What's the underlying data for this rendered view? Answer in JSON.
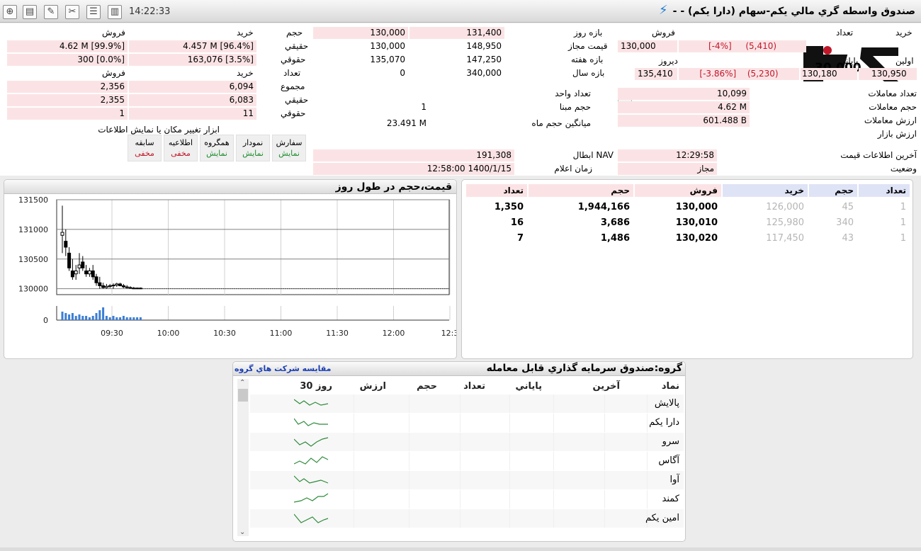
{
  "toolbar": {
    "clock": "14:22:33",
    "title": "صندوق واسطه گري مالي يكم-سهام (دارا يكم) - -",
    "icons": [
      "plus-square-icon",
      "calculator-icon",
      "edit-icon",
      "tools-icon",
      "list-icon",
      "bar-chart-icon",
      "bolt-icon"
    ]
  },
  "logo": {
    "visible_text": "30.000"
  },
  "price_block": {
    "buy_label": "خريد",
    "buy_count_label": "تعداد",
    "sell_label": "فروش",
    "last_value": "130,000",
    "last_change": "(5,410)",
    "last_change_pct": "[-4%]",
    "first_label": "اولين",
    "first_value": "130,950",
    "close_label": "پاياني",
    "close_value": "130,180",
    "close_change": "(5,230)",
    "close_change_pct": "[-3.86%]",
    "yesterday_label": "ديروز",
    "yesterday_value": "135,410"
  },
  "stats_right": {
    "trades_count_label": "تعداد معاملات",
    "trades_count": "10,099",
    "volume_label": "حجم معاملات",
    "volume": "4.62 M",
    "value_label": "ارزش معاملات",
    "value": "601.488 B",
    "market_value_label": "ارزش بازار",
    "market_value": "",
    "last_info_label": "آخرين اطلاعات قيمت",
    "last_info_time": "12:29:58",
    "status_label": "وضعيت",
    "status": "مجاز"
  },
  "ranges": {
    "day_label": "بازه روز",
    "day_low": "130,000",
    "day_high": "131,400",
    "allowed_label": "قيمت مجاز",
    "allowed_low": "130,000",
    "allowed_high": "148,950",
    "week_label": "بازه هفته",
    "week_low": "135,070",
    "week_high": "147,250",
    "year_label": "بازه سال",
    "year_low": "0",
    "year_high": "340,000"
  },
  "mid_info": {
    "unit_count_label": "تعداد واحد",
    "base_volume_label": "حجم مبنا",
    "base_volume": "1",
    "avg_month_label": "ميانگين حجم ماه",
    "avg_month": "23.491 M",
    "nav_label": "NAV ابطال",
    "nav": "191,308",
    "announce_label": "زمان اعلام",
    "announce_time": "12:58:00 1400/1/15"
  },
  "investor": {
    "buy_label": "خريد",
    "sell_label": "فروش",
    "volume_label": "حجم",
    "real_label": "حقيقي",
    "legal_label": "حقوقي",
    "count_label": "تعداد",
    "total_label": "مجموع",
    "vol_real_buy": "4.457 M [96.4%]",
    "vol_real_sell": "4.62 M [99.9%]",
    "vol_legal_buy": "163,076 [3.5%]",
    "vol_legal_sell": "300 [0.0%]",
    "cnt_total_buy": "6,094",
    "cnt_total_sell": "2,356",
    "cnt_real_buy": "6,083",
    "cnt_real_sell": "2,355",
    "cnt_legal_buy": "11",
    "cnt_legal_sell": "1"
  },
  "display_tools": {
    "title": "ابزار تغيير مكان يا نمايش اطلاعات",
    "items": [
      {
        "name": "سفارش",
        "state": "نمايش"
      },
      {
        "name": "نمودار",
        "state": "نمايش"
      },
      {
        "name": "همگروه",
        "state": "نمايش"
      },
      {
        "name": "اطلاعيه",
        "state": "مخفی"
      },
      {
        "name": "سابقه",
        "state": "مخفی"
      }
    ]
  },
  "chart_panel": {
    "title": "قيمت،حجم در طول روز"
  },
  "chart_data": {
    "type": "candlestick",
    "title": "قيمت،حجم در طول روز",
    "xlabel": "",
    "ylabel": "",
    "x_ticks": [
      "09:30",
      "10:00",
      "10:30",
      "11:00",
      "11:30",
      "12:00",
      "12:3"
    ],
    "y_ticks": [
      131500,
      131000,
      130500,
      130000
    ],
    "volume_y_ticks": [
      0
    ],
    "ylim": [
      129900,
      131500
    ],
    "series": [
      {
        "values": [
          {
            "t": "09:02",
            "o": 130900,
            "h": 131400,
            "l": 130600,
            "c": 130950
          },
          {
            "t": "09:03",
            "o": 130800,
            "h": 131000,
            "l": 130550,
            "c": 130700
          },
          {
            "t": "09:04",
            "o": 130600,
            "h": 130700,
            "l": 130300,
            "c": 130350
          },
          {
            "t": "09:05",
            "o": 130300,
            "h": 130500,
            "l": 130150,
            "c": 130200
          },
          {
            "t": "09:06",
            "o": 130250,
            "h": 130400,
            "l": 130150,
            "c": 130300
          },
          {
            "t": "09:07",
            "o": 130350,
            "h": 130600,
            "l": 130250,
            "c": 130400
          },
          {
            "t": "09:08",
            "o": 130450,
            "h": 130550,
            "l": 130300,
            "c": 130350
          },
          {
            "t": "09:09",
            "o": 130300,
            "h": 130400,
            "l": 130200,
            "c": 130250
          },
          {
            "t": "09:10",
            "o": 130250,
            "h": 130350,
            "l": 130200,
            "c": 130300
          },
          {
            "t": "09:11",
            "o": 130300,
            "h": 130400,
            "l": 130150,
            "c": 130200
          },
          {
            "t": "09:12",
            "o": 130200,
            "h": 130250,
            "l": 130050,
            "c": 130100
          },
          {
            "t": "09:13",
            "o": 130100,
            "h": 130200,
            "l": 130000,
            "c": 130050
          },
          {
            "t": "09:14",
            "o": 130050,
            "h": 130100,
            "l": 130000,
            "c": 130020
          },
          {
            "t": "09:15",
            "o": 130020,
            "h": 130080,
            "l": 130000,
            "c": 130040
          },
          {
            "t": "09:16",
            "o": 130040,
            "h": 130080,
            "l": 130010,
            "c": 130050
          },
          {
            "t": "09:17",
            "o": 130050,
            "h": 130090,
            "l": 130000,
            "c": 130060
          },
          {
            "t": "09:18",
            "o": 130060,
            "h": 130100,
            "l": 130030,
            "c": 130080
          },
          {
            "t": "09:19",
            "o": 130080,
            "h": 130100,
            "l": 130040,
            "c": 130050
          },
          {
            "t": "09:20",
            "o": 130050,
            "h": 130080,
            "l": 130010,
            "c": 130030
          },
          {
            "t": "09:21",
            "o": 130030,
            "h": 130060,
            "l": 130000,
            "c": 130020
          },
          {
            "t": "09:22",
            "o": 130020,
            "h": 130040,
            "l": 130000,
            "c": 130010
          },
          {
            "t": "09:23",
            "o": 130010,
            "h": 130030,
            "l": 130000,
            "c": 130000
          },
          {
            "t": "09:24",
            "o": 130000,
            "h": 130020,
            "l": 130000,
            "c": 130010
          },
          {
            "t": "09:25",
            "o": 130010,
            "h": 130020,
            "l": 130000,
            "c": 130000
          }
        ]
      }
    ],
    "volumes": [
      0.6,
      0.5,
      0.4,
      0.5,
      0.3,
      0.4,
      0.3,
      0.3,
      0.2,
      0.3,
      0.5,
      0.7,
      0.9,
      0.3,
      0.2,
      0.3,
      0.2,
      0.2,
      0.3,
      0.2,
      0.2,
      0.2,
      0.2,
      0.2
    ]
  },
  "orderbook": {
    "headers": [
      "تعداد",
      "حجم",
      "خريد",
      "فروش",
      "حجم",
      "تعداد"
    ],
    "rows": [
      {
        "buy_count": "1",
        "buy_volume": "45",
        "buy_price": "126,000",
        "sell_price": "130,000",
        "sell_volume": "1,944,166",
        "sell_count": "1,350"
      },
      {
        "buy_count": "1",
        "buy_volume": "340",
        "buy_price": "125,980",
        "sell_price": "130,010",
        "sell_volume": "3,686",
        "sell_count": "16"
      },
      {
        "buy_count": "1",
        "buy_volume": "43",
        "buy_price": "117,450",
        "sell_price": "130,020",
        "sell_volume": "1,486",
        "sell_count": "7"
      }
    ]
  },
  "group": {
    "title": "گروه:صندوق سرمايه گذاري قابل معامله",
    "link": "مقايسه شركت هاي گروه",
    "headers": [
      "نماد",
      "آخرين",
      "پاياني",
      "تعداد",
      "حجم",
      "ارزش",
      "30 روز"
    ],
    "rows": [
      {
        "symbol": "پالايش"
      },
      {
        "symbol": "دارا يكم"
      },
      {
        "symbol": "سرو"
      },
      {
        "symbol": "آگاس"
      },
      {
        "symbol": "آوا"
      },
      {
        "symbol": "كمند"
      },
      {
        "symbol": "امين يكم"
      }
    ],
    "sparkline_color": "#2e8b3a"
  }
}
